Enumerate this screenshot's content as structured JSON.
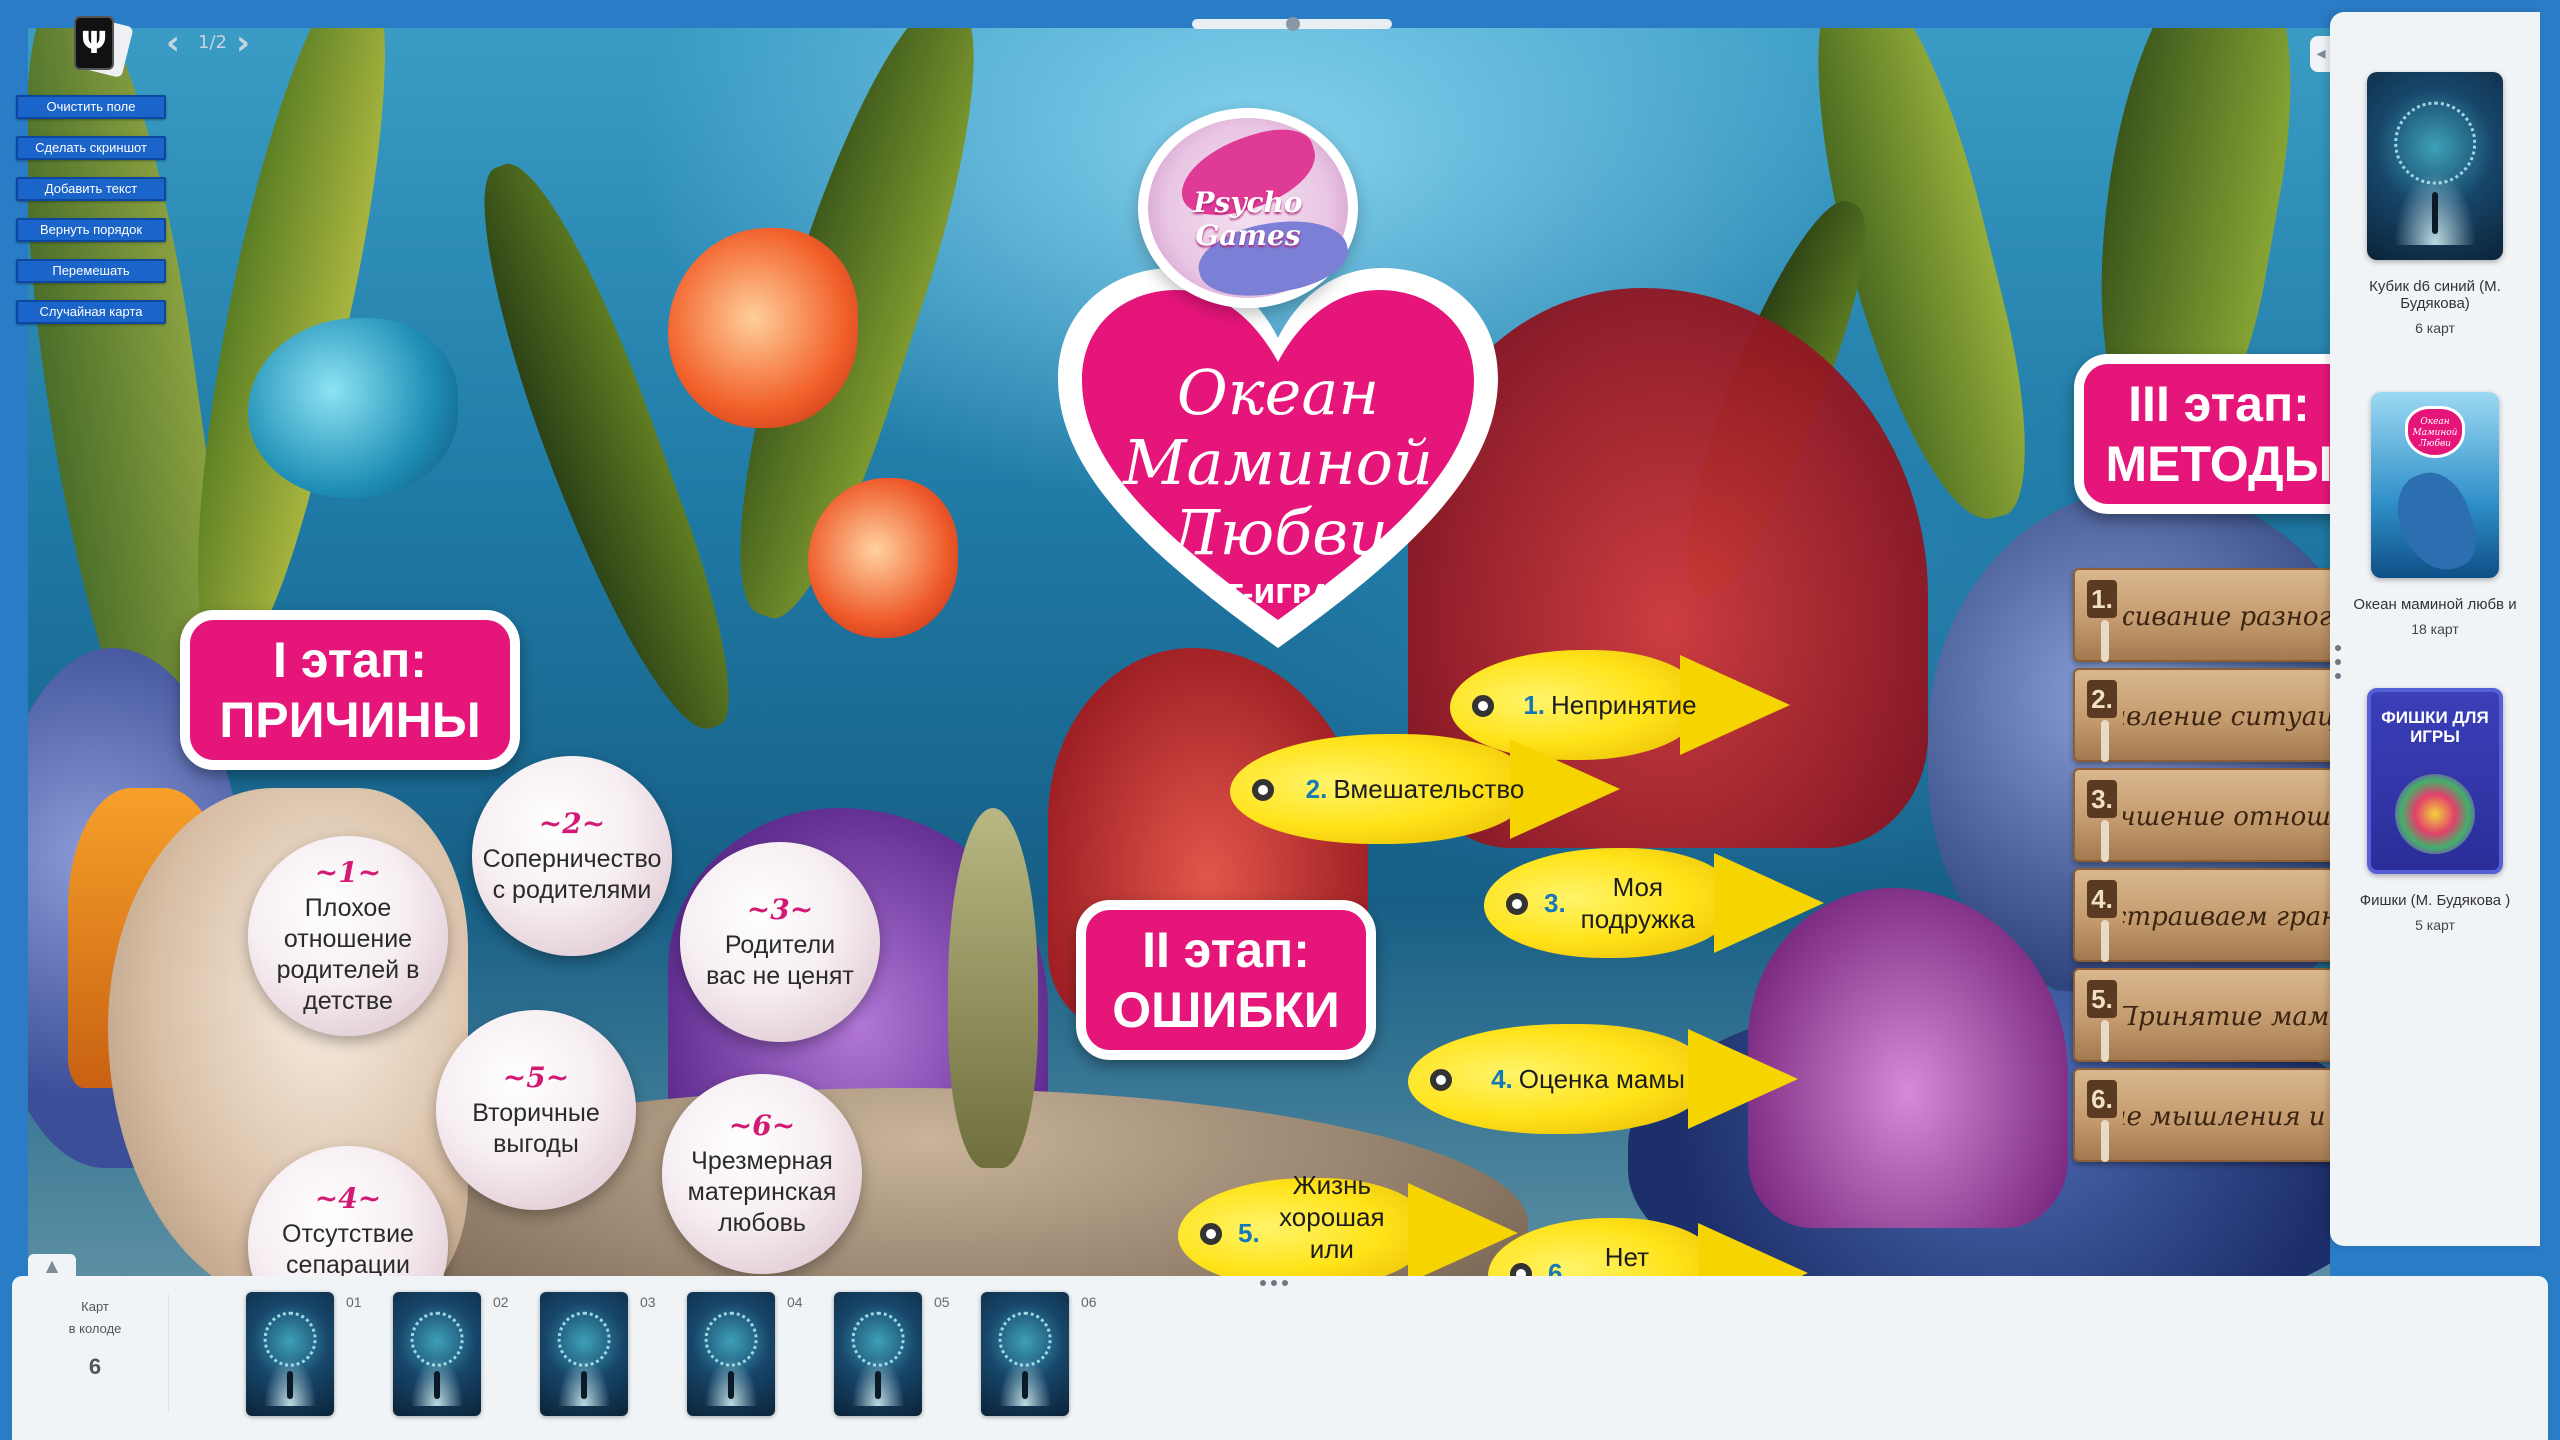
{
  "toolbar": {
    "page_indicator": "1/2",
    "buttons": [
      "Очистить поле",
      "Сделать скриншот",
      "Добавить текст",
      "Вернуть порядок",
      "Перемешать",
      "Случайная карта"
    ]
  },
  "board": {
    "logo": {
      "brand": "Psycho Games",
      "title_lines": [
        "Океан",
        "Маминой",
        "Любви"
      ],
      "subtitle": "Т-ИГРА"
    },
    "stages": [
      {
        "line1": "I этап:",
        "line2": "ПРИЧИНЫ"
      },
      {
        "line1": "II этап:",
        "line2": "ОШИБКИ"
      },
      {
        "line1": "III этап:",
        "line2": "МЕТОДЫ"
      }
    ],
    "causes": [
      {
        "num": "~1~",
        "text": "Плохое отношение родителей в детстве"
      },
      {
        "num": "~2~",
        "text": "Соперничество с родителями"
      },
      {
        "num": "~3~",
        "text": "Родители вас не ценят"
      },
      {
        "num": "~4~",
        "text": "Отсутствие сепарации"
      },
      {
        "num": "~5~",
        "text": "Вторичные выгоды"
      },
      {
        "num": "~6~",
        "text": "Чрезмерная материнская любовь"
      }
    ],
    "mistakes": [
      {
        "num": "1.",
        "text": "Непринятие"
      },
      {
        "num": "2.",
        "text": "Вмешательство"
      },
      {
        "num": "3.",
        "text": "Моя подружка"
      },
      {
        "num": "4.",
        "text": "Оценка мамы"
      },
      {
        "num": "5.",
        "text": "Жизнь хорошая или плохая"
      },
      {
        "num": "6.",
        "text": "Нет ошибок"
      }
    ],
    "methods": [
      {
        "num": "1.",
        "text": "Улаживание разногласий"
      },
      {
        "num": "2.",
        "text": "Управление ситуациями"
      },
      {
        "num": "3.",
        "text": "Улучшение отношений"
      },
      {
        "num": "4.",
        "text": "Выстраиваем границы"
      },
      {
        "num": "5.",
        "text": "Принятие мамы"
      },
      {
        "num": "6.",
        "text": "Изменение мышления и поведения"
      }
    ]
  },
  "right_panel": {
    "decks": [
      {
        "name": "Кубик d6 синий (М. Будякова)",
        "count": "6 карт"
      },
      {
        "name": "Океан маминой любв и",
        "count": "18 карт",
        "thumb_lines": [
          "Океан",
          "Маминой",
          "Любви"
        ]
      },
      {
        "name": "Фишки (М. Будякова )",
        "count": "5 карт",
        "thumb_title": "ФИШКИ ДЛЯ ИГРЫ"
      }
    ]
  },
  "tray": {
    "label_line1": "Карт",
    "label_line2": "в колоде",
    "count": "6",
    "card_numbers": [
      "01",
      "02",
      "03",
      "04",
      "05",
      "06"
    ]
  },
  "colors": {
    "accent_pink": "#e6157a",
    "button_blue": "#1b64c9",
    "frame_blue": "#2a7cc7",
    "fish_yellow": "#ffe31a"
  },
  "icons": [
    "app-logo-icon",
    "arrow-left-icon",
    "arrow-right-icon",
    "panel-collapse-icon",
    "tray-collapse-icon",
    "drag-handle-icon"
  ]
}
